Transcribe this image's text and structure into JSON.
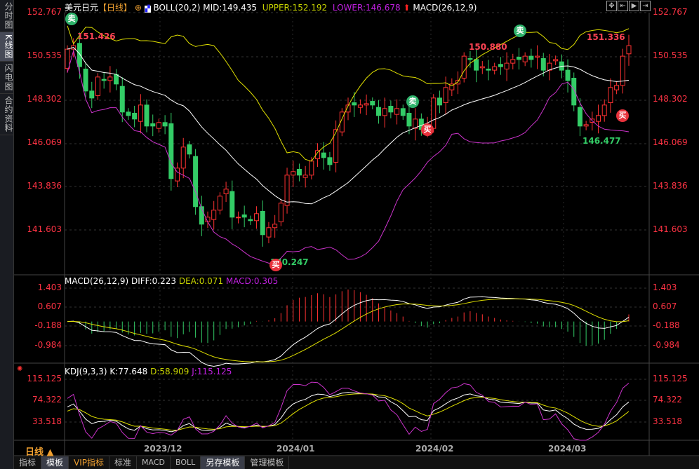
{
  "sidebar": {
    "items": [
      {
        "label": "分时图"
      },
      {
        "label": "K线图",
        "active": true
      },
      {
        "label": "闪电图"
      },
      {
        "label": "合约资料"
      }
    ]
  },
  "header": {
    "symbol": "美元日元",
    "period": "【日线】",
    "boll": "BOLL(20,2)",
    "mid": "MID:149.435",
    "upper": "UPPER:152.192",
    "lower": "LOWER:146.678",
    "macd": "MACD(26,12,9)"
  },
  "toolbar": {
    "icons": [
      "crosshair-icon",
      "zoom-in-icon",
      "zoom-out-icon",
      "move-right-icon"
    ]
  },
  "colors": {
    "up": "#ff3232",
    "down": "#33cc66",
    "mid": "#ffffff",
    "upper": "#e0e000",
    "lower": "#cc33cc",
    "axis": "#ff3344"
  },
  "price_axis": [
    "152.767",
    "150.535",
    "148.302",
    "146.069",
    "143.836",
    "141.603"
  ],
  "macd_panel": {
    "title": "MACD(26,12,9)",
    "diff": "DIFF:0.223",
    "dea": "DEA:0.071",
    "macd": "MACD:0.305",
    "axis": [
      "1.403",
      "0.607",
      "-0.188",
      "-0.984"
    ]
  },
  "kdj_panel": {
    "title": "KDJ(9,3,3)",
    "k": "K:77.648",
    "d": "D:58.909",
    "j": "J:115.125",
    "axis": [
      "115.125",
      "74.322",
      "33.518"
    ]
  },
  "annotations": {
    "high1": "151.426",
    "high2": "150.880",
    "high3": "151.336",
    "low1": "140.247",
    "low2": "146.477",
    "sell": "卖",
    "buy": "买"
  },
  "dates": [
    "2023/12",
    "2024/01",
    "2024/02",
    "2024/03"
  ],
  "period_label": "日线 ▲",
  "bottom_tabs": [
    "指标",
    "模板",
    "VIP指标",
    "标准",
    "MACD",
    "BOLL",
    "另存模板",
    "管理模板"
  ],
  "chart_data": {
    "type": "candlestick",
    "title": "美元日元 日线",
    "first_open": 149.9,
    "closes": [
      150.89,
      151.07,
      149.99,
      148.74,
      148.38,
      149.46,
      149.28,
      149.46,
      149.1,
      147.66,
      147.48,
      147.3,
      148.02,
      146.94,
      146.94,
      147.12,
      146.94,
      144.24,
      144.78,
      145.86,
      145.5,
      142.8,
      141.9,
      142.26,
      142.62,
      143.34,
      143.7,
      142.26,
      142.26,
      142.26,
      142.08,
      142.44,
      141.36,
      141.72,
      141.9,
      142.98,
      144.42,
      144.6,
      144.42,
      144.42,
      145.14,
      145.68,
      145.32,
      144.96,
      146.76,
      147.66,
      148.02,
      148.02,
      148.02,
      148.09,
      148.02,
      147.48,
      147.84,
      147.66,
      147.84,
      147.48,
      146.94,
      147.3,
      146.76,
      146.94,
      148.38,
      148.02,
      148.92,
      149.1,
      149.28,
      150.53,
      150.36,
      149.81,
      149.99,
      149.81,
      149.99,
      149.99,
      150.17,
      150.36,
      150.36,
      150.53,
      150.36,
      150.53,
      149.81,
      150.17,
      150.36,
      149.81,
      149.28,
      148.02,
      146.94,
      147.01,
      147.3,
      147.48,
      148.02,
      148.92,
      149.03,
      150.53,
      151.07
    ],
    "ylim": [
      140.0,
      153.2
    ]
  }
}
